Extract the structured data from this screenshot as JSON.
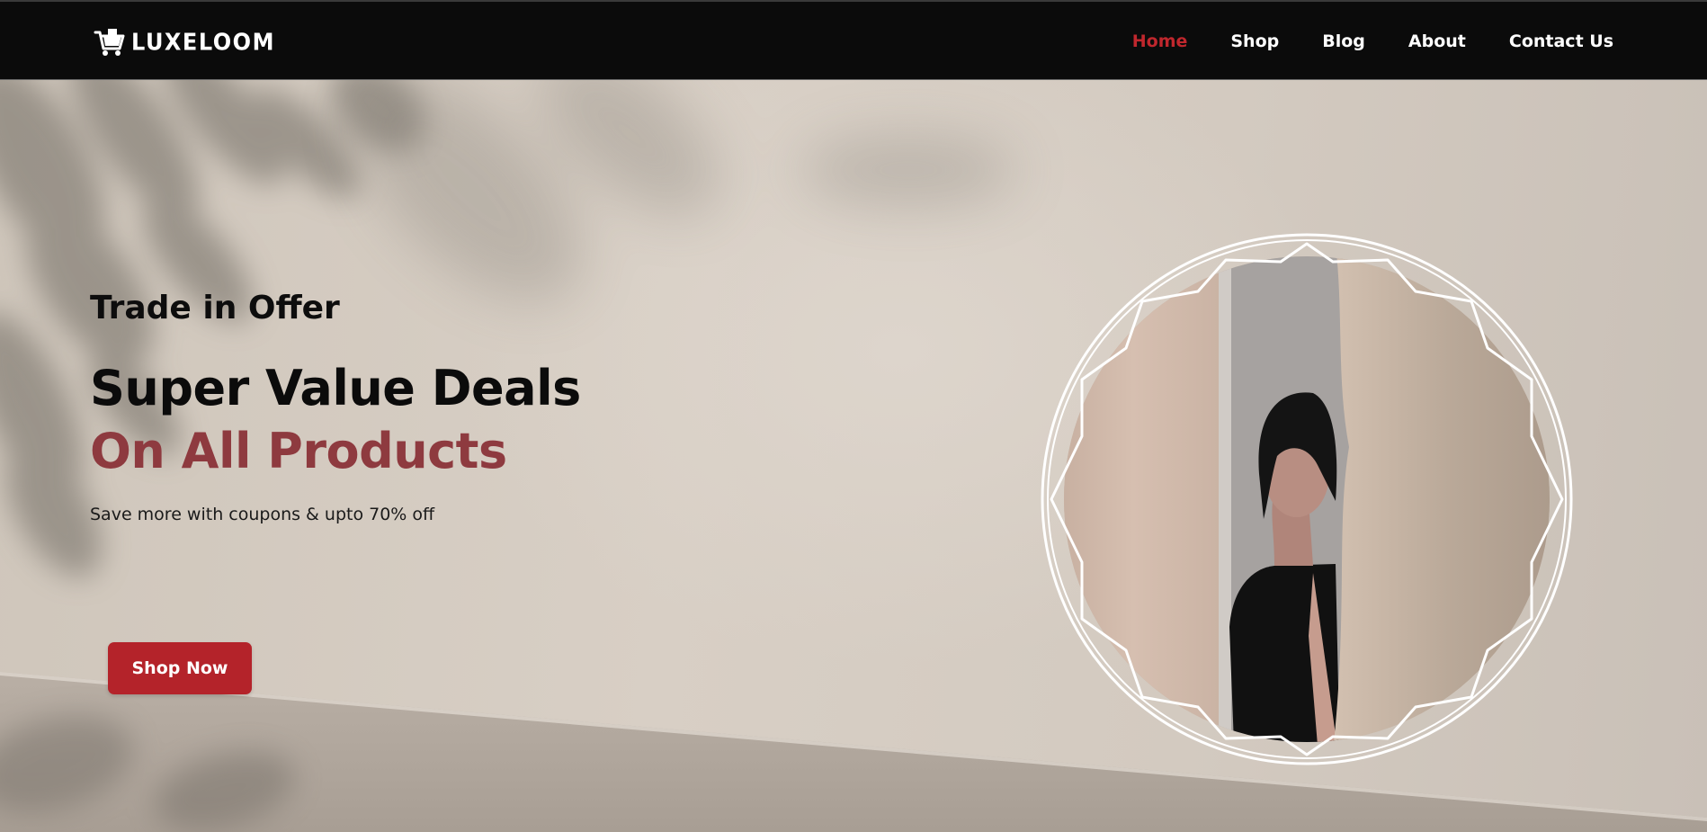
{
  "header": {
    "brand": "LUXELOOM",
    "logo_icon": "shopping-cart-icon",
    "nav": [
      {
        "label": "Home",
        "active": true
      },
      {
        "label": "Shop",
        "active": false
      },
      {
        "label": "Blog",
        "active": false
      },
      {
        "label": "About",
        "active": false
      },
      {
        "label": "Contact Us",
        "active": false
      }
    ]
  },
  "hero": {
    "eyebrow": "Trade in Offer",
    "headline_line1": "Super Value Deals",
    "headline_line2": "On All Products",
    "subtext": "Save more with coupons & upto 70% off",
    "cta_label": "Shop Now"
  },
  "colors": {
    "header_bg": "#0b0b0b",
    "nav_active": "#c0272d",
    "accent_text": "#8e3a3f",
    "cta_bg": "#b4232a",
    "hero_bg": "#d4cbc1"
  }
}
